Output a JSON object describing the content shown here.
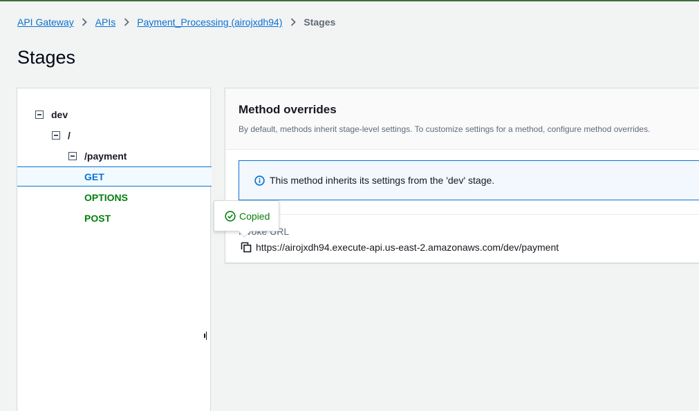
{
  "breadcrumb": {
    "items": [
      "API Gateway",
      "APIs",
      "Payment_Processing (airojxdh94)"
    ],
    "current": "Stages"
  },
  "page": {
    "title": "Stages"
  },
  "tree": {
    "stage": "dev",
    "root_resource": "/",
    "resource": "/payment",
    "methods": [
      "GET",
      "OPTIONS",
      "POST"
    ],
    "selected_method": "GET"
  },
  "detail": {
    "title": "Method overrides",
    "description": "By default, methods inherit stage-level settings. To customize settings for a method, configure method overrides.",
    "alert": "This method inherits its settings from the 'dev' stage.",
    "invoke_label": "Invoke URL",
    "invoke_url": "https://airojxdh94.execute-api.us-east-2.amazonaws.com/dev/payment"
  },
  "tooltip": {
    "text": "Copied"
  },
  "colors": {
    "link": "#0972d3",
    "success": "#037f0c",
    "info_bg": "#f2f8fd",
    "selected_bg": "#f1faff"
  }
}
